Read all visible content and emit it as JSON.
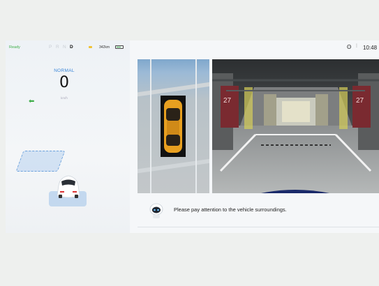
{
  "status": {
    "ready_label": "Ready",
    "gears": [
      "P",
      "R",
      "N",
      "D"
    ],
    "active_gear": "D",
    "range": "342km",
    "clock": "10:48",
    "bluetooth_icon": "bluetooth-icon",
    "signal_icon": "signal-icon"
  },
  "cluster": {
    "drive_mode": "NORMAL",
    "speed": "0",
    "speed_unit": "km/h",
    "turn_signal_icon": "left-arrow-icon"
  },
  "camera": {
    "pillar_left": "27",
    "pillar_right": "27"
  },
  "hint": {
    "message": "Please pay attention to the vehicle surroundings.",
    "robot_icon": "assistant-robot-icon"
  },
  "colors": {
    "accent_green": "#3fae4a",
    "accent_blue": "#3a86d8",
    "car_orange": "#e8a020"
  }
}
